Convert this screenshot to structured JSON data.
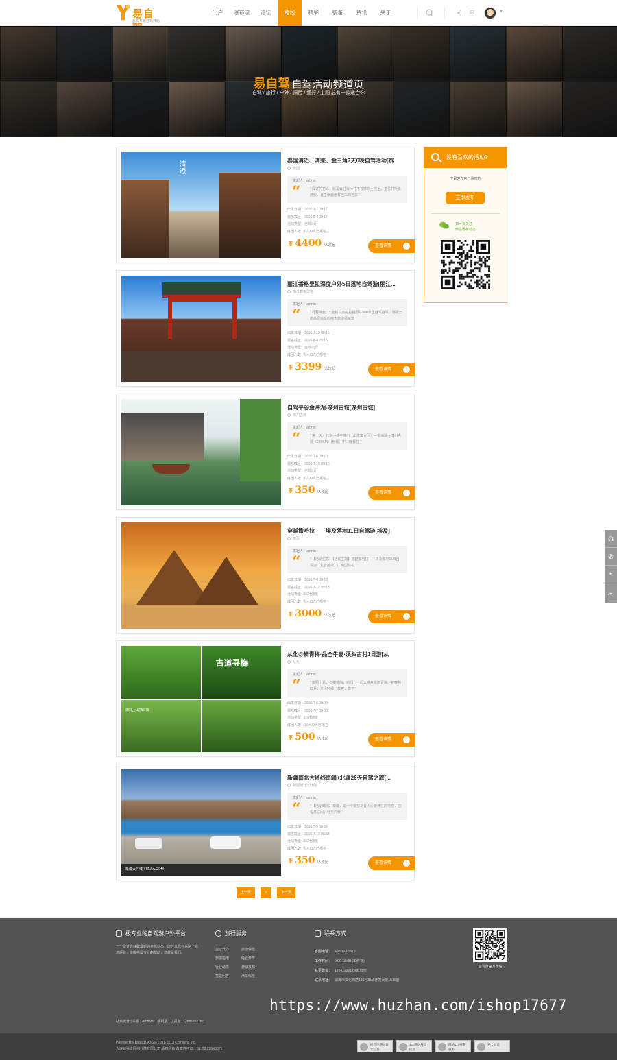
{
  "header": {
    "logo_name": "易自驾",
    "logo_sub": "自驾从易自驾开始",
    "nav": [
      "门户",
      "瀑布流",
      "论坛",
      "路线",
      "精彩",
      "装备",
      "资讯",
      "关于"
    ],
    "active_nav": 3
  },
  "banner": {
    "title_accent": "易自驾",
    "title": "自驾活动频道页",
    "subtitle": "自驾 / 旅行 / 户外 / 探险 / 爱好 / 主题 总有一款适合你"
  },
  "labels": {
    "author_prefix": "发起人：",
    "depart": "出发日期：",
    "deadline": "报名截止：",
    "type": "活动类型：",
    "members": "成团人数：",
    "detail_button": "查看详情",
    "unit": "/人次起",
    "currency": "¥"
  },
  "activities": [
    {
      "title": "泰国清迈、清莱、金三角7天6晚自驾活动[泰",
      "location": "泰国",
      "author": "admin",
      "quote": "“ 探讨的意义，就是去往每一寸不曾感的土地上，多看并听多感受。让生命里重有自由的色彩 ”",
      "depart": "2016-7-7 09:17",
      "deadline": "2016-8-4 09:17",
      "type": "自驾出行",
      "members": "0人/0人已报名",
      "price": "4400"
    },
    {
      "title": "丽江香格里拉深度户外5日落地自驾游[丽江...",
      "location": "丽江香格里拉",
      "author": "admin",
      "quote": "“ 行程特色：* 全新三菱帕拉越野车500公里自驾自驾，驰骋云南高原遍览的两大旅游领域景 ”",
      "depart": "2016-7-13 09:16",
      "deadline": "2016-8-4 09:16",
      "type": "自驾出行",
      "members": "0人/0人已报名",
      "price": "3399"
    },
    {
      "title": "自驾平谷金海湖-滦州古城[滦州古城]",
      "location": "滦州古城",
      "author": "admin",
      "quote": "“ 第一天：北京—昌平滦州（出发集合区）—金海湖—滦州古城（280KM）用 餐：中、晚餐住 ”",
      "depart": "2016-7-6 09:15",
      "deadline": "2016-7-15 09:15",
      "type": "自驾出行",
      "members": "0人/0人已报名",
      "price": "350"
    },
    {
      "title": "穿越撒哈拉——埃及落地11日自驾游[埃及]",
      "location": "埃及",
      "author": "admin",
      "quote": "“ 【活动信息】【活动主题】穿越撒哈拉——埃及落地11日自驾游【集合地点】广州国际机 ”",
      "depart": "2016-7-6 09:13",
      "deadline": "2016-7-12 09:13",
      "type": "出外游玩",
      "members": "0人/0人已报名",
      "price": "3000"
    },
    {
      "title": "从化@摘青梅·品全牛宴·溪头古村1日游[从",
      "location": "从化",
      "author": "admin",
      "quote": "“ 按照上总，但带着梅，到们，一起去进从化摘青梅。初春的四月，万木吐绿，春意，春了 ”",
      "depart": "2016-7-6 09:00",
      "deadline": "2016-7-7 09:00",
      "type": "出外游玩",
      "members": "10人/0人已报名",
      "price": "500"
    },
    {
      "title": "新疆南北大环线南疆+北疆26天自驾之旅[...",
      "location": "新疆南北大环线",
      "author": "admin",
      "quote": "“ 【活动概况】新疆，是一个很容易让人心驰神往的地方，它幅员辽阔，壮美的景 ”",
      "depart": "2016-7-5 08:58",
      "deadline": "2016-7-12 08:58",
      "type": "出外游玩",
      "members": "0人/0人已报名",
      "price": "350"
    }
  ],
  "sidebar": {
    "head": "没有喜欢的活动?",
    "tip": "立即发布自己喜欢的",
    "publish": "立即发布",
    "wechat_1": "扫一扫关注",
    "wechat_2": "微信最新动态"
  },
  "photo_captions": {
    "qingmai": "清迈",
    "qingmei": "古道寻梅",
    "qingmei_sub": "摘好上山摘青梅",
    "xinjiang": "新疆大环线  YIZIJIA.COM"
  },
  "pager": [
    "上一页",
    "1",
    "下一页"
  ],
  "footer": {
    "col1_head": "极专业的自驾游户外平台",
    "col1_text": "一个能让您获取最新的自驾动态，能分享您自驾路上点滴经验，能提供最专业的帮助，这就是我们。",
    "col2_head": "旅行服务",
    "col2_links": [
      "签证代办",
      "旅游保险",
      "旅游指南",
      "经验分享",
      "行业动态",
      "游记攻略",
      "签证问答",
      "汽车保险"
    ],
    "col3_head": "联系方式",
    "contacts": [
      {
        "k": "客服电话：",
        "v": "400 123 1678"
      },
      {
        "k": "工作时间：",
        "v": "9:00-18:00 (工作日)"
      },
      {
        "k": "意见建议：",
        "v": "125422921@qq.com"
      },
      {
        "k": "联系地址：",
        "v": "威海市文化西路180号邮政开发大厦1610室"
      }
    ],
    "qr_caption": "自驾游官方微信",
    "bottom_links": "站点统计  |  举报  |  Archiver  |  手机版  |  小黑屋  |  Comsenz Inc.",
    "watermark": "https://www.huzhan.com/ishop17677",
    "copy_1": "Powered by Discuz! X3.2© 2001-2013 Comsenz Inc.",
    "copy_2": "大连记事本网络科技有限公司 版权所有   备案许可证：B1.B2-20140071",
    "badges": [
      "经营性网站备案信息",
      "360网站安全检测",
      "网络110报警服务",
      "安全认证"
    ]
  },
  "colors": {
    "accent": "#f39600",
    "footer": "#525252"
  }
}
